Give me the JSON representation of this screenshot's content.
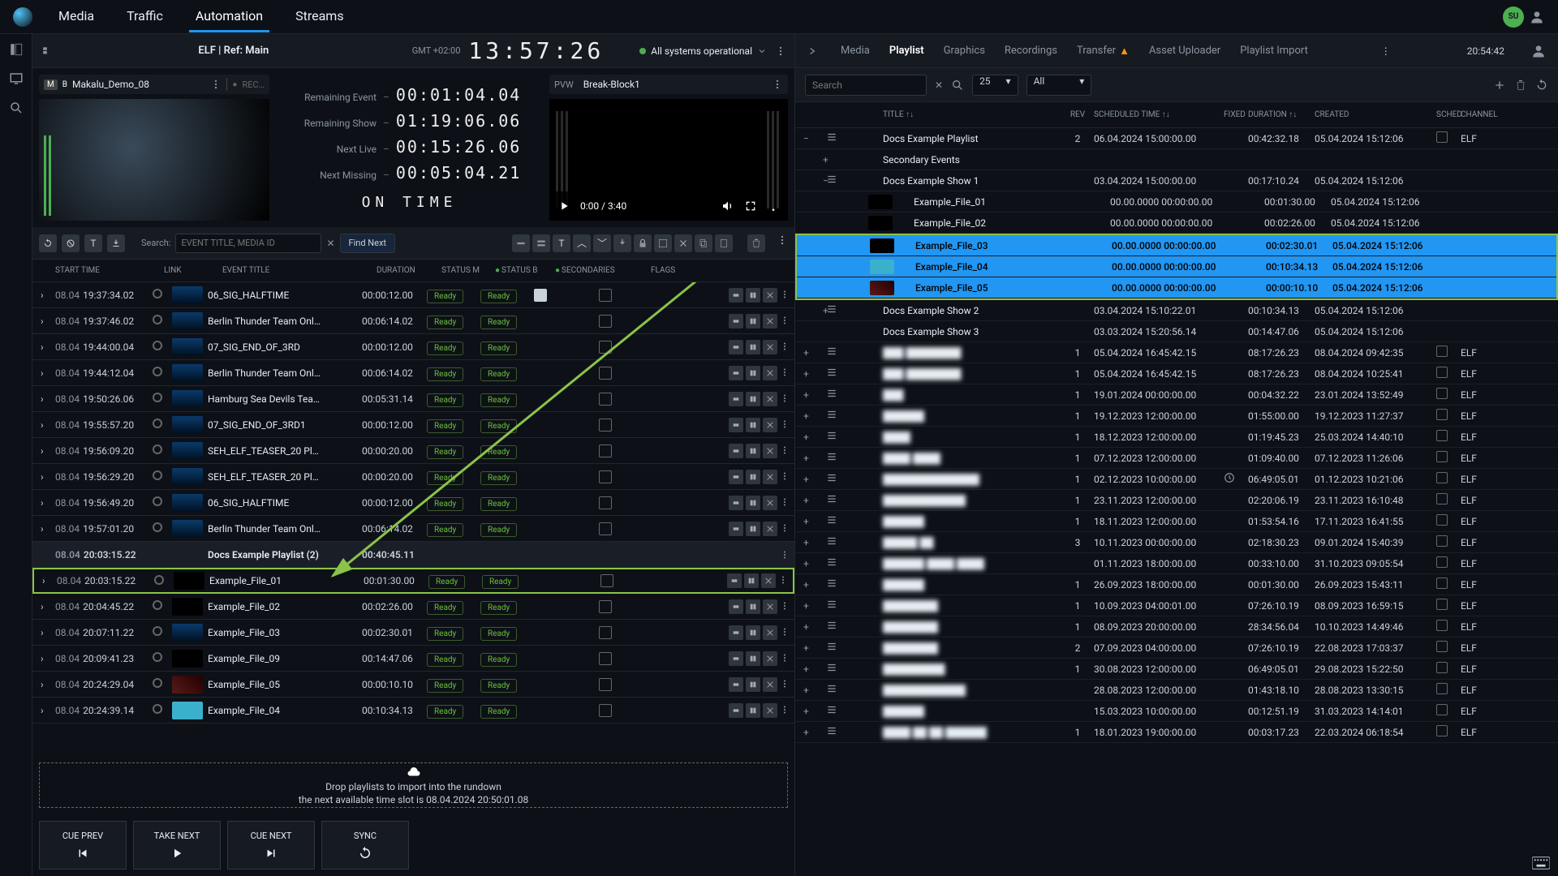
{
  "topnav": [
    "Media",
    "Traffic",
    "Automation",
    "Streams"
  ],
  "topnav_active": 2,
  "avatar": "SU",
  "channel": "ELF | Ref: Main",
  "timezone": "GMT +02:00",
  "clock": "13:57:26",
  "system_status": "All systems operational",
  "program": {
    "badge_m": "M",
    "badge_b": "B",
    "name": "Makalu_Demo_08",
    "rec": "REC…"
  },
  "stats": {
    "remaining_event": "00:01:04.04",
    "remaining_show": "01:19:06.06",
    "next_live": "00:15:26.06",
    "next_missing": "00:05:04.21",
    "status": "ON TIME"
  },
  "preview": {
    "label": "PVW",
    "name": "Break-Block1",
    "player_time": "0:00 / 3:40"
  },
  "search": {
    "label": "Search:",
    "placeholder": "EVENT TITLE, MEDIA ID",
    "find_next": "Find Next"
  },
  "rundown_cols": {
    "start": "START TIME",
    "link": "LINK",
    "title": "EVENT TITLE",
    "dur": "DURATION",
    "stm": "STATUS M",
    "stb": "STATUS B",
    "sec": "SECONDARIES",
    "flags": "FLAGS"
  },
  "rundown": [
    {
      "d": "08.04",
      "t": "19:37:34.02",
      "title": "06_SIG_HALFTIME",
      "dur": "00:00:12.00",
      "m": "Ready",
      "b": "Ready",
      "sec": true,
      "thumb": "blue"
    },
    {
      "d": "08.04",
      "t": "19:37:46.02",
      "title": "Berlin Thunder Team Onl…",
      "dur": "00:06:14.02",
      "m": "Ready",
      "b": "Ready",
      "thumb": "blue"
    },
    {
      "d": "08.04",
      "t": "19:44:00.04",
      "title": "07_SIG_END_OF_3RD",
      "dur": "00:00:12.00",
      "m": "Ready",
      "b": "Ready",
      "thumb": "blue"
    },
    {
      "d": "08.04",
      "t": "19:44:12.04",
      "title": "Berlin Thunder Team Onl…",
      "dur": "00:06:14.02",
      "m": "Ready",
      "b": "Ready",
      "thumb": "blue"
    },
    {
      "d": "08.04",
      "t": "19:50:26.06",
      "title": "Hamburg Sea Devils Tea…",
      "dur": "00:05:31.14",
      "m": "Ready",
      "b": "Ready",
      "thumb": "blue"
    },
    {
      "d": "08.04",
      "t": "19:55:57.20",
      "title": "07_SIG_END_OF_3RD1",
      "dur": "00:00:12.00",
      "m": "Ready",
      "b": "Ready",
      "thumb": "blue"
    },
    {
      "d": "08.04",
      "t": "19:56:09.20",
      "title": "SEH_ELF_TEASER_20 Pl…",
      "dur": "00:00:20.00",
      "m": "Ready",
      "b": "Ready",
      "thumb": "blue"
    },
    {
      "d": "08.04",
      "t": "19:56:29.20",
      "title": "SEH_ELF_TEASER_20 Pl…",
      "dur": "00:00:20.00",
      "m": "Ready",
      "b": "Ready",
      "thumb": "blue"
    },
    {
      "d": "08.04",
      "t": "19:56:49.20",
      "title": "06_SIG_HALFTIME",
      "dur": "00:00:12.00",
      "m": "Ready",
      "b": "Ready",
      "thumb": "blue"
    },
    {
      "d": "08.04",
      "t": "19:57:01.20",
      "title": "Berlin Thunder Team Onl…",
      "dur": "00:06:14.02",
      "m": "Ready",
      "b": "Ready",
      "thumb": "blue"
    },
    {
      "type": "playlist",
      "d": "08.04",
      "t": "20:03:15.22",
      "title": "Docs Example Playlist (2)",
      "dur": "00:40:45.11"
    },
    {
      "d": "08.04",
      "t": "20:03:15.22",
      "title": "Example_File_01",
      "dur": "00:01:30.00",
      "m": "Ready",
      "b": "Ready",
      "thumb": "black",
      "hl": true
    },
    {
      "d": "08.04",
      "t": "20:04:45.22",
      "title": "Example_File_02",
      "dur": "00:02:26.00",
      "m": "Ready",
      "b": "Ready",
      "thumb": "black"
    },
    {
      "d": "08.04",
      "t": "20:07:11.22",
      "title": "Example_File_03",
      "dur": "00:02:30.01",
      "m": "Ready",
      "b": "Ready",
      "thumb": "blue"
    },
    {
      "d": "08.04",
      "t": "20:09:41.23",
      "title": "Example_File_09",
      "dur": "00:14:47.06",
      "m": "Ready",
      "b": "Ready",
      "thumb": "black"
    },
    {
      "d": "08.04",
      "t": "20:24:29.04",
      "title": "Example_File_05",
      "dur": "00:00:10.10",
      "m": "Ready",
      "b": "Ready",
      "thumb": "red"
    },
    {
      "d": "08.04",
      "t": "20:24:39.14",
      "title": "Example_File_04",
      "dur": "00:10:34.13",
      "m": "Ready",
      "b": "Ready",
      "thumb": "cyan"
    }
  ],
  "dropzone": {
    "line1": "Drop playlists to import into the rundown",
    "line2": "the next available time slot is 08.04.2024 20:50:01.08"
  },
  "cue": {
    "prev": "CUE PREV",
    "take": "TAKE NEXT",
    "next": "CUE NEXT",
    "sync": "SYNC"
  },
  "right_tabs": [
    "Media",
    "Playlist",
    "Graphics",
    "Recordings",
    "Transfer",
    "Asset Uploader",
    "Playlist Import"
  ],
  "right_tabs_active": 1,
  "right_clock": "20:54:42",
  "right_filter": {
    "search": "Search",
    "page": "25",
    "filter": "All"
  },
  "plist_cols": {
    "title": "TITLE",
    "rev": "REV",
    "sched": "SCHEDULED TIME",
    "fixed": "FIXED",
    "dur": "DURATION",
    "created": "CREATED",
    "sched_chan": "SCHED",
    "chan": "CHANNEL"
  },
  "plist": [
    {
      "exp": "−",
      "ic": "list",
      "title": "Docs Example Playlist",
      "rev": "2",
      "sched": "06.04.2024 15:00:00.00",
      "dur": "00:42:32.18",
      "created": "05.04.2024 15:12:06",
      "chk": true,
      "chan": "ELF"
    },
    {
      "exp": "+",
      "title": "Secondary Events",
      "indent": 1
    },
    {
      "exp": "−",
      "ic": "list",
      "title": "Docs Example Show 1",
      "sched": "03.04.2024 15:00:00.00",
      "dur": "00:17:10.24",
      "created": "05.04.2024 15:12:06",
      "indent": 1
    },
    {
      "title": "Example_File_01",
      "sched": "00.00.0000 00:00:00.00",
      "dur": "00:01:30.00",
      "created": "05.04.2024 15:12:06",
      "indent": 2,
      "thumb": "black"
    },
    {
      "title": "Example_File_02",
      "sched": "00.00.0000 00:00:00.00",
      "dur": "00:02:26.00",
      "created": "05.04.2024 15:12:06",
      "indent": 2,
      "thumb": "black"
    },
    {
      "title": "Example_File_03",
      "sched": "00.00.0000 00:00:00.00",
      "dur": "00:02:30.01",
      "created": "05.04.2024 15:12:06",
      "indent": 2,
      "sel": true,
      "thumb": "black"
    },
    {
      "title": "Example_File_04",
      "sched": "00.00.0000 00:00:00.00",
      "dur": "00:10:34.13",
      "created": "05.04.2024 15:12:06",
      "indent": 2,
      "sel": true,
      "thumb": "blue"
    },
    {
      "title": "Example_File_05",
      "sched": "00.00.0000 00:00:00.00",
      "dur": "00:00:10.10",
      "created": "05.04.2024 15:12:06",
      "indent": 2,
      "sel": true,
      "thumb": "red"
    },
    {
      "exp": "+",
      "ic": "list",
      "title": "Docs Example Show 2",
      "sched": "03.04.2024 15:10:22.01",
      "dur": "00:10:34.13",
      "created": "05.04.2024 15:12:06",
      "indent": 1
    },
    {
      "title": "Docs Example Show 3",
      "sched": "03.03.2024 15:20:56.14",
      "dur": "00:14:47.06",
      "created": "05.04.2024 15:12:06",
      "indent": 1
    },
    {
      "exp": "+",
      "ic": "list",
      "title": "███ ████████",
      "rev": "1",
      "sched": "05.04.2024 16:45:42.15",
      "dur": "08:17:26.23",
      "created": "08.04.2024 09:42:35",
      "chk": true,
      "chan": "ELF",
      "blur": true
    },
    {
      "exp": "+",
      "ic": "list",
      "title": "███ ████████",
      "rev": "1",
      "sched": "05.04.2024 16:45:42.15",
      "dur": "08:17:26.23",
      "created": "08.04.2024 10:25:41",
      "chk": true,
      "chan": "ELF",
      "blur": true
    },
    {
      "exp": "+",
      "ic": "list",
      "title": "███",
      "rev": "1",
      "sched": "19.01.2024 00:00:00.00",
      "dur": "00:04:32.22",
      "created": "23.01.2024 13:52:49",
      "chk": true,
      "chan": "ELF",
      "blur": true
    },
    {
      "exp": "+",
      "ic": "list",
      "title": "██████",
      "rev": "1",
      "sched": "19.12.2023 12:00:00.00",
      "dur": "01:55:00.00",
      "created": "19.12.2023 11:27:37",
      "chk": true,
      "chan": "ELF",
      "blur": true
    },
    {
      "exp": "+",
      "ic": "list",
      "title": "████",
      "rev": "1",
      "sched": "18.12.2023 12:00:00.00",
      "dur": "01:19:45.23",
      "created": "25.03.2024 14:40:10",
      "chk": true,
      "chan": "ELF",
      "blur": true
    },
    {
      "exp": "+",
      "ic": "list",
      "title": "████ ████",
      "rev": "1",
      "sched": "07.12.2023 12:00:00.00",
      "dur": "01:09:40.00",
      "created": "07.12.2023 11:26:06",
      "chk": true,
      "chan": "ELF",
      "blur": true
    },
    {
      "exp": "+",
      "ic": "list",
      "title": "██████████████",
      "rev": "1",
      "sched": "02.12.2023 10:00:00.00",
      "dur": "06:49:05.01",
      "created": "01.12.2023 10:21:06",
      "chk": true,
      "chan": "ELF",
      "blur": true,
      "fixed": true
    },
    {
      "exp": "+",
      "ic": "list",
      "title": "████████████",
      "rev": "1",
      "sched": "23.11.2023 12:00:00.00",
      "dur": "02:20:06.19",
      "created": "23.11.2023 16:10:48",
      "chk": true,
      "chan": "ELF",
      "blur": true
    },
    {
      "exp": "+",
      "ic": "list",
      "title": "██████",
      "rev": "1",
      "sched": "18.11.2023 12:00:00.00",
      "dur": "01:53:54.16",
      "created": "17.11.2023 16:41:55",
      "chk": true,
      "chan": "ELF",
      "blur": true
    },
    {
      "exp": "+",
      "ic": "list",
      "title": "█████ ██",
      "rev": "3",
      "sched": "10.11.2023 00:00:00.00",
      "dur": "02:18:30.23",
      "created": "09.01.2024 15:40:39",
      "chk": true,
      "chan": "ELF",
      "blur": true
    },
    {
      "exp": "+",
      "ic": "list",
      "title": "██████ ████ ████",
      "sched": "01.11.2023 18:00:00.00",
      "dur": "00:33:10.00",
      "created": "31.10.2023 09:05:54",
      "chk": true,
      "chan": "ELF",
      "blur": true
    },
    {
      "exp": "+",
      "ic": "list",
      "title": "██████",
      "rev": "1",
      "sched": "26.09.2023 18:00:00.00",
      "dur": "00:01:30.00",
      "created": "26.09.2023 15:43:11",
      "chk": true,
      "chan": "ELF",
      "blur": true
    },
    {
      "exp": "+",
      "ic": "list",
      "title": "████████",
      "rev": "1",
      "sched": "10.09.2023 04:00:01.00",
      "dur": "07:26:10.19",
      "created": "08.09.2023 16:59:15",
      "chk": true,
      "chan": "ELF",
      "blur": true
    },
    {
      "exp": "+",
      "ic": "list",
      "title": "████████",
      "rev": "1",
      "sched": "08.09.2023 20:00:00.00",
      "dur": "28:34:56.04",
      "created": "10.10.2023 14:49:46",
      "chk": true,
      "chan": "ELF",
      "blur": true
    },
    {
      "exp": "+",
      "ic": "list",
      "title": "████████",
      "rev": "2",
      "sched": "07.09.2023 04:00:00.00",
      "dur": "07:26:10.19",
      "created": "22.08.2023 17:03:37",
      "chk": true,
      "chan": "ELF",
      "blur": true
    },
    {
      "exp": "+",
      "ic": "list",
      "title": "█████████",
      "rev": "1",
      "sched": "30.08.2023 12:00:00.00",
      "dur": "06:49:05.01",
      "created": "29.08.2023 15:22:50",
      "chk": true,
      "chan": "ELF",
      "blur": true
    },
    {
      "exp": "+",
      "ic": "list",
      "title": "████████████",
      "sched": "28.08.2023 12:00:00.00",
      "dur": "01:43:18.10",
      "created": "28.08.2023 13:30:15",
      "chk": true,
      "chan": "ELF",
      "blur": true
    },
    {
      "exp": "+",
      "ic": "list",
      "title": "██████",
      "sched": "15.03.2023 10:00:00.00",
      "dur": "00:12:51.19",
      "created": "31.03.2023 14:14:01",
      "chk": true,
      "chan": "ELF",
      "blur": true
    },
    {
      "exp": "+",
      "ic": "list",
      "title": "████ ██ ██ ██████",
      "rev": "1",
      "sched": "18.01.2023 19:00:00.00",
      "dur": "00:03:17.23",
      "created": "22.03.2024 06:18:54",
      "chk": true,
      "chan": "ELF",
      "blur": true
    }
  ]
}
